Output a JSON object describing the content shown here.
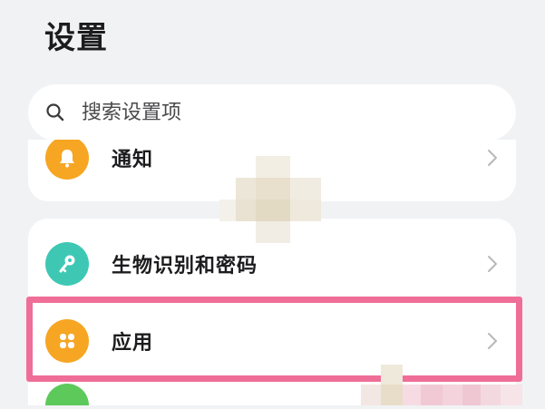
{
  "header": {
    "title": "设置"
  },
  "search": {
    "placeholder": "搜索设置项"
  },
  "groups": [
    {
      "items": [
        {
          "label": "通知",
          "icon": "bell-icon",
          "color": "#f6a623"
        }
      ]
    },
    {
      "items": [
        {
          "label": "生物识别和密码",
          "icon": "key-icon",
          "color": "#3ec8b4"
        },
        {
          "label": "应用",
          "icon": "apps-grid-icon",
          "color": "#f6a623"
        },
        {
          "label": "",
          "icon": "partial-icon",
          "color": "#5dc95b"
        }
      ]
    }
  ],
  "highlight": {
    "color": "#ef6e98",
    "target": "应用"
  }
}
